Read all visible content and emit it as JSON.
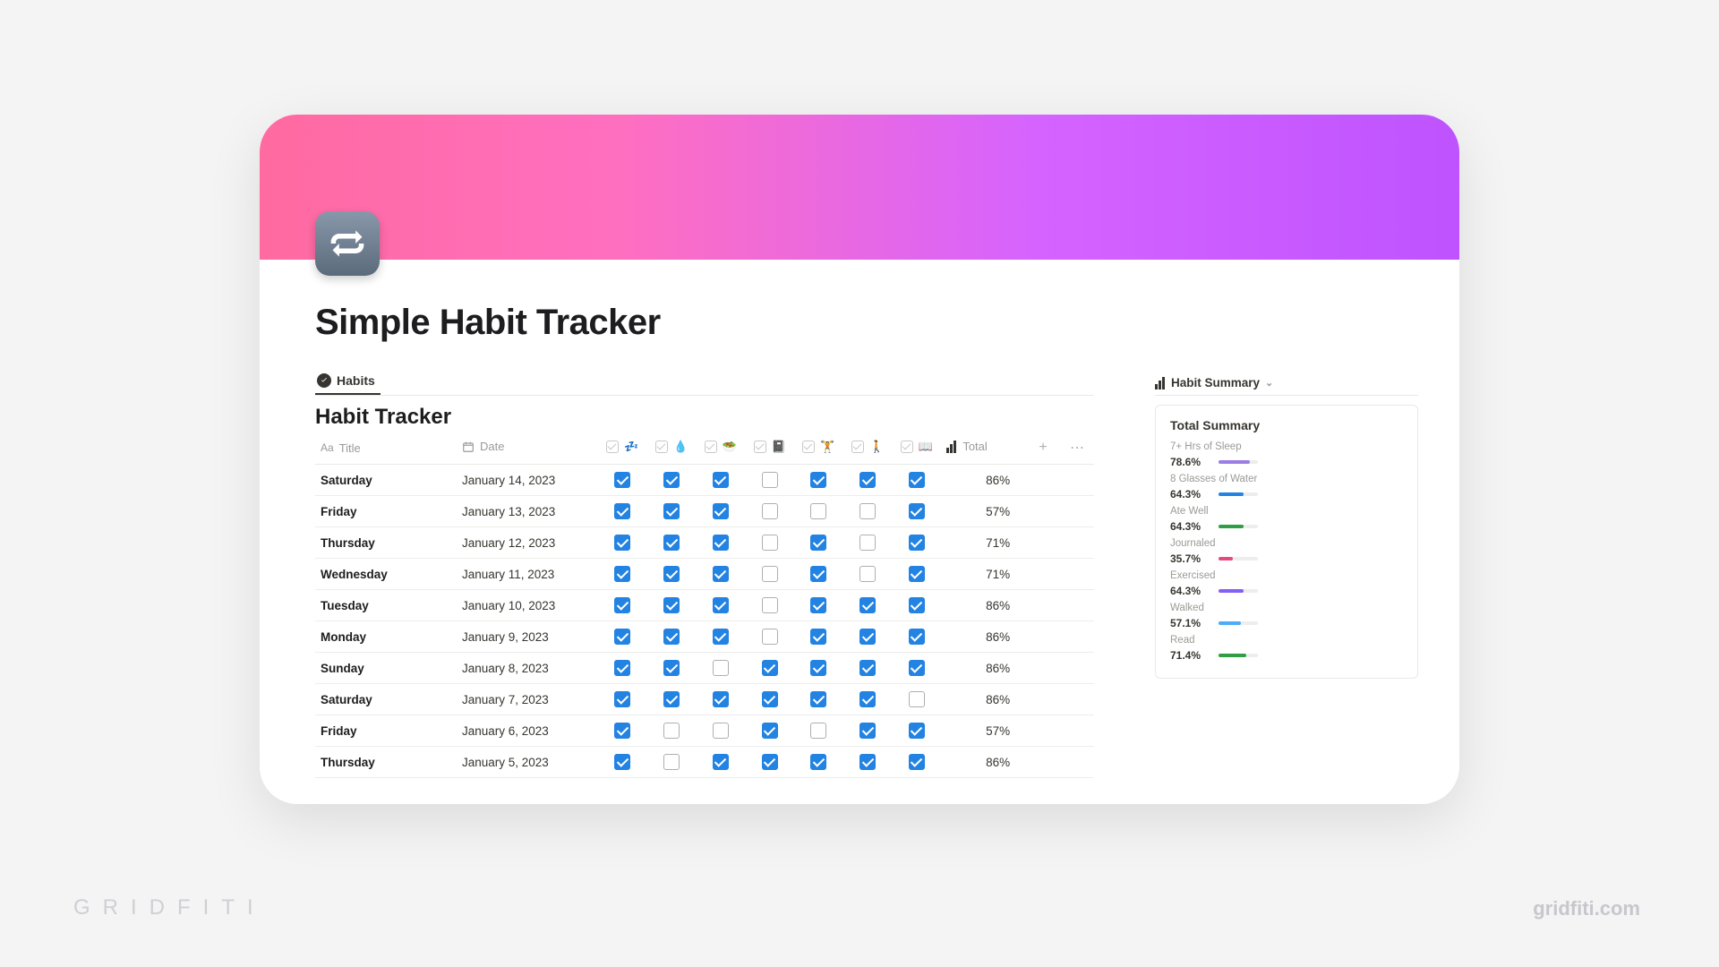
{
  "page": {
    "title": "Simple Habit Tracker"
  },
  "tabs": {
    "habits": "Habits"
  },
  "table": {
    "title": "Habit Tracker",
    "headers": {
      "title": "Title",
      "date": "Date",
      "total": "Total"
    },
    "habit_icons": [
      "💤",
      "💧",
      "🥗",
      "📓",
      "🏋️",
      "🚶",
      "📖"
    ],
    "rows": [
      {
        "day": "Saturday",
        "date": "January 14, 2023",
        "checks": [
          true,
          true,
          true,
          false,
          true,
          true,
          true
        ],
        "total": "86%"
      },
      {
        "day": "Friday",
        "date": "January 13, 2023",
        "checks": [
          true,
          true,
          true,
          false,
          false,
          false,
          true
        ],
        "total": "57%"
      },
      {
        "day": "Thursday",
        "date": "January 12, 2023",
        "checks": [
          true,
          true,
          true,
          false,
          true,
          false,
          true
        ],
        "total": "71%"
      },
      {
        "day": "Wednesday",
        "date": "January 11, 2023",
        "checks": [
          true,
          true,
          true,
          false,
          true,
          false,
          true
        ],
        "total": "71%"
      },
      {
        "day": "Tuesday",
        "date": "January 10, 2023",
        "checks": [
          true,
          true,
          true,
          false,
          true,
          true,
          true
        ],
        "total": "86%"
      },
      {
        "day": "Monday",
        "date": "January 9, 2023",
        "checks": [
          true,
          true,
          true,
          false,
          true,
          true,
          true
        ],
        "total": "86%"
      },
      {
        "day": "Sunday",
        "date": "January 8, 2023",
        "checks": [
          true,
          true,
          false,
          true,
          true,
          true,
          true
        ],
        "total": "86%"
      },
      {
        "day": "Saturday",
        "date": "January 7, 2023",
        "checks": [
          true,
          true,
          true,
          true,
          true,
          true,
          false
        ],
        "total": "86%"
      },
      {
        "day": "Friday",
        "date": "January 6, 2023",
        "checks": [
          true,
          false,
          false,
          true,
          false,
          true,
          true
        ],
        "total": "57%"
      },
      {
        "day": "Thursday",
        "date": "January 5, 2023",
        "checks": [
          true,
          false,
          true,
          true,
          true,
          true,
          true
        ],
        "total": "86%"
      }
    ]
  },
  "summary": {
    "tab_label": "Habit Summary",
    "card_title": "Total Summary",
    "stats": [
      {
        "label": "7+ Hrs of Sleep",
        "pct": "78.6%",
        "value": 78.6,
        "color": "#9b7ee5"
      },
      {
        "label": "8 Glasses of Water",
        "pct": "64.3%",
        "value": 64.3,
        "color": "#2383e2"
      },
      {
        "label": "Ate Well",
        "pct": "64.3%",
        "value": 64.3,
        "color": "#2f9e44"
      },
      {
        "label": "Journaled",
        "pct": "35.7%",
        "value": 35.7,
        "color": "#e64980"
      },
      {
        "label": "Exercised",
        "pct": "64.3%",
        "value": 64.3,
        "color": "#845ef7"
      },
      {
        "label": "Walked",
        "pct": "57.1%",
        "value": 57.1,
        "color": "#4dabf7"
      },
      {
        "label": "Read",
        "pct": "71.4%",
        "value": 71.4,
        "color": "#2f9e44"
      }
    ]
  },
  "watermark": {
    "left": "GRIDFITI",
    "right": "gridfiti.com"
  },
  "chart_data": {
    "type": "bar",
    "title": "Total Summary",
    "categories": [
      "7+ Hrs of Sleep",
      "8 Glasses of Water",
      "Ate Well",
      "Journaled",
      "Exercised",
      "Walked",
      "Read"
    ],
    "values": [
      78.6,
      64.3,
      64.3,
      35.7,
      64.3,
      57.1,
      71.4
    ],
    "xlabel": "",
    "ylabel": "%",
    "ylim": [
      0,
      100
    ]
  }
}
